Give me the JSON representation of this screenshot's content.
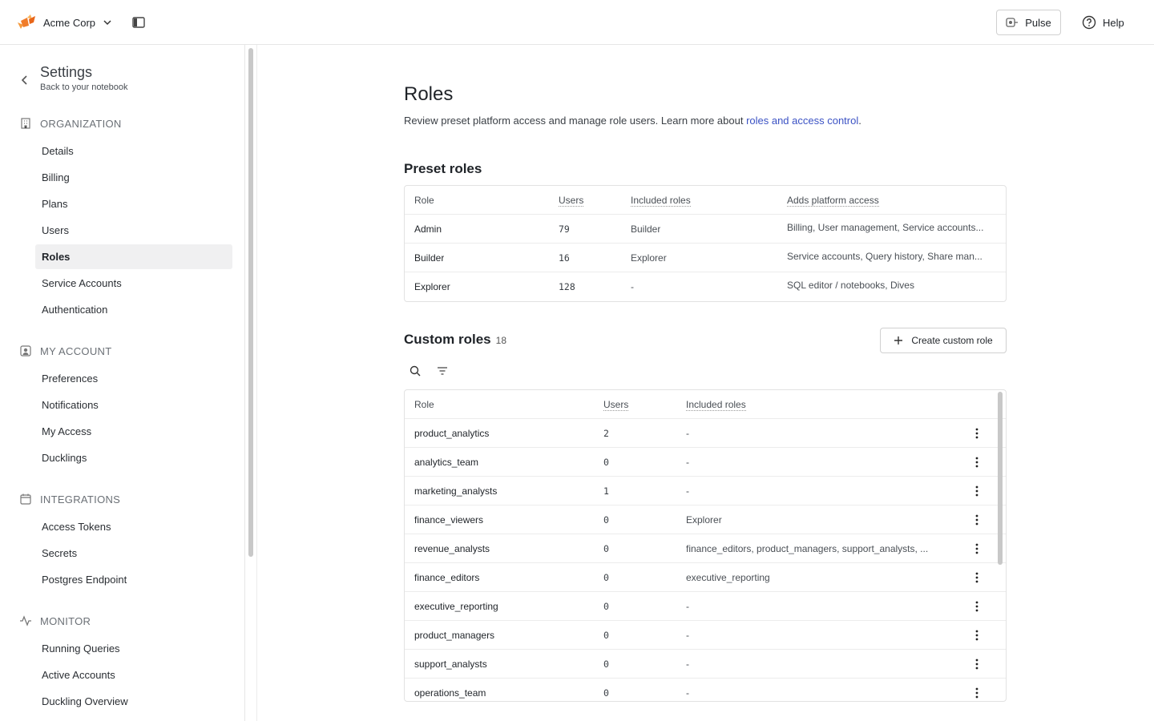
{
  "topbar": {
    "org_name": "Acme Corp",
    "pulse_label": "Pulse",
    "help_label": "Help",
    "brand_color": "#f07c2a"
  },
  "sidebar": {
    "title": "Settings",
    "subtitle": "Back to your notebook",
    "sections": [
      {
        "label": "ORGANIZATION",
        "icon": "building-icon",
        "items": [
          "Details",
          "Billing",
          "Plans",
          "Users",
          "Roles",
          "Service Accounts",
          "Authentication"
        ]
      },
      {
        "label": "MY ACCOUNT",
        "icon": "user-square-icon",
        "items": [
          "Preferences",
          "Notifications",
          "My Access",
          "Ducklings"
        ]
      },
      {
        "label": "INTEGRATIONS",
        "icon": "calendar-icon",
        "items": [
          "Access Tokens",
          "Secrets",
          "Postgres Endpoint"
        ]
      },
      {
        "label": "MONITOR",
        "icon": "activity-icon",
        "items": [
          "Running Queries",
          "Active Accounts",
          "Duckling Overview"
        ]
      }
    ],
    "active_item": "Roles"
  },
  "page": {
    "title": "Roles",
    "description": "Review preset platform access and manage role users. Learn more about ",
    "link_text": "roles and access control",
    "description_end": "."
  },
  "preset": {
    "heading": "Preset roles",
    "headers": [
      "Role",
      "Users",
      "Included roles",
      "Adds platform access"
    ],
    "rows": [
      [
        "Admin",
        "79",
        "Builder",
        "Billing, User management, Service accounts..."
      ],
      [
        "Builder",
        "16",
        "Explorer",
        "Service accounts, Query history, Share man..."
      ],
      [
        "Explorer",
        "128",
        "-",
        "SQL editor / notebooks, Dives"
      ]
    ]
  },
  "custom": {
    "heading": "Custom roles",
    "count": "18",
    "create_label": "Create custom role",
    "headers": [
      "Role",
      "Users",
      "Included roles"
    ],
    "rows": [
      [
        "product_analytics",
        "2",
        "-"
      ],
      [
        "analytics_team",
        "0",
        "-"
      ],
      [
        "marketing_analysts",
        "1",
        "-"
      ],
      [
        "finance_viewers",
        "0",
        "Explorer"
      ],
      [
        "revenue_analysts",
        "0",
        "finance_editors, product_managers, support_analysts, ..."
      ],
      [
        "finance_editors",
        "0",
        "executive_reporting"
      ],
      [
        "executive_reporting",
        "0",
        "-"
      ],
      [
        "product_managers",
        "0",
        "-"
      ],
      [
        "support_analysts",
        "0",
        "-"
      ],
      [
        "operations_team",
        "0",
        "-"
      ]
    ]
  }
}
